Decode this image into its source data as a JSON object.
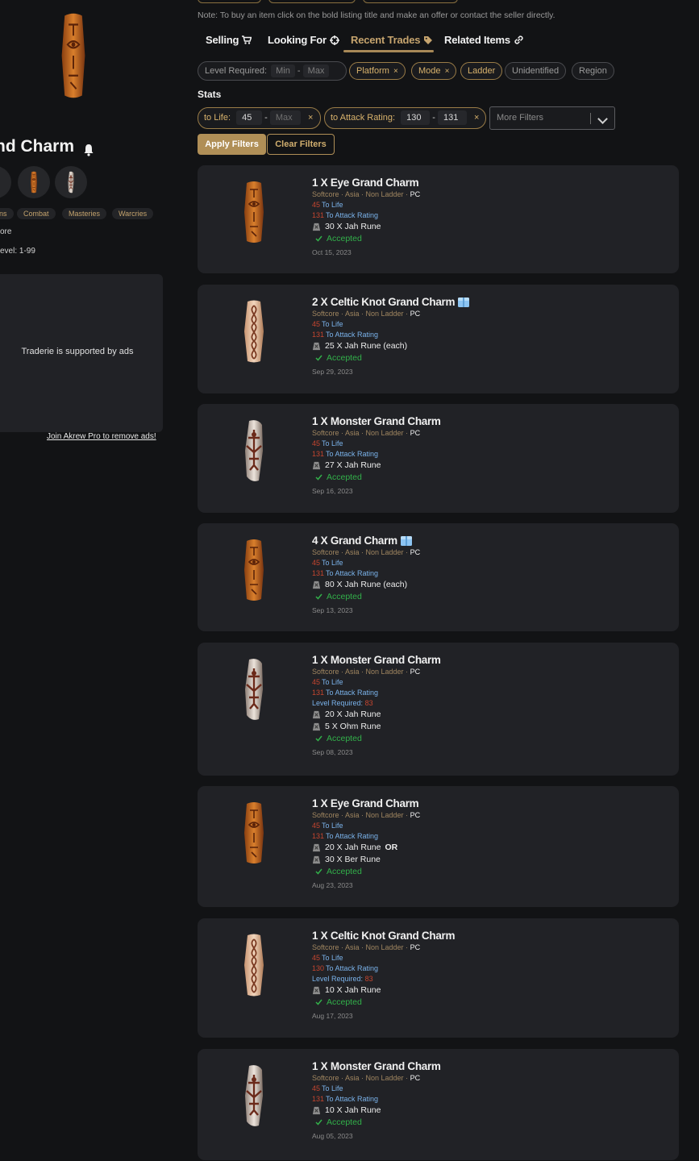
{
  "sidebar": {
    "title": "nd Charm",
    "tags": [
      "ns",
      "Combat",
      "Masteries",
      "Warcries"
    ],
    "info": [
      "ore",
      "evel: 1-99"
    ],
    "ad_text": "Traderie is supported by ads",
    "pro_link": "Join Akrew Pro to remove ads!"
  },
  "note": "Note: To buy an item click on the bold listing title and make an offer or contact the seller directly.",
  "tabs": [
    {
      "label": "Selling",
      "icon": "cart-icon"
    },
    {
      "label": "Looking For",
      "icon": "target-icon"
    },
    {
      "label": "Recent Trades",
      "icon": "tag-icon",
      "active": true
    },
    {
      "label": "Related Items",
      "icon": "link-icon"
    }
  ],
  "filters": {
    "level_label": "Level Required:",
    "min_placeholder": "Min",
    "max_placeholder": "Max",
    "dash": "-",
    "platform": "Platform",
    "mode": "Mode",
    "ladder": "Ladder",
    "unidentified": "Unidentified",
    "region": "Region",
    "remove": "×"
  },
  "stats": {
    "label": "Stats",
    "life": {
      "label": "to Life:",
      "min": "45",
      "max_placeholder": "Max"
    },
    "attack": {
      "label": "to Attack Rating:",
      "min": "130",
      "max": "131"
    },
    "more_filters": "More Filters"
  },
  "buttons": {
    "apply": "Apply Filters",
    "clear": "Clear Filters"
  },
  "trades": [
    {
      "title": "1 X Eye Grand Charm",
      "charm": "eye",
      "box": false,
      "meta": "Softcore · Asia · Non Ladder · ",
      "platform": "PC",
      "life_val": "45",
      "life_label": "To Life",
      "ar_val": "131",
      "ar_label": "To Attack Rating",
      "level_label": "",
      "level_val": "",
      "offer1": "30 X Jah Rune",
      "offer_or": "",
      "offer2": "",
      "status": "Accepted",
      "date": "Oct 15, 2023"
    },
    {
      "title": "2 X Celtic Knot Grand Charm",
      "charm": "celtic",
      "box": true,
      "meta": "Softcore · Asia · Non Ladder · ",
      "platform": "PC",
      "life_val": "45",
      "life_label": "To Life",
      "ar_val": "131",
      "ar_label": "To Attack Rating",
      "level_label": "",
      "level_val": "",
      "offer1": "25 X Jah Rune (each)",
      "offer_or": "",
      "offer2": "",
      "status": "Accepted",
      "date": "Sep 29, 2023"
    },
    {
      "title": "1 X Monster Grand Charm",
      "charm": "monster",
      "box": false,
      "meta": "Softcore · Asia · Non Ladder · ",
      "platform": "PC",
      "life_val": "45",
      "life_label": "To Life",
      "ar_val": "131",
      "ar_label": "To Attack Rating",
      "level_label": "",
      "level_val": "",
      "offer1": "27 X Jah Rune",
      "offer_or": "",
      "offer2": "",
      "status": "Accepted",
      "date": "Sep 16, 2023"
    },
    {
      "title": "4 X Grand Charm",
      "charm": "eye",
      "box": true,
      "meta": "Softcore · Asia · Non Ladder · ",
      "platform": "PC",
      "life_val": "45",
      "life_label": "To Life",
      "ar_val": "131",
      "ar_label": "To Attack Rating",
      "level_label": "",
      "level_val": "",
      "offer1": "80 X Jah Rune (each)",
      "offer_or": "",
      "offer2": "",
      "status": "Accepted",
      "date": "Sep 13, 2023"
    },
    {
      "title": "1 X Monster Grand Charm",
      "charm": "monster",
      "box": false,
      "meta": "Softcore · Asia · Non Ladder · ",
      "platform": "PC",
      "life_val": "45",
      "life_label": "To Life",
      "ar_val": "131",
      "ar_label": "To Attack Rating",
      "level_label": "Level Required:",
      "level_val": "83",
      "offer1": "20 X Jah Rune",
      "offer_or": "",
      "offer2": "5 X Ohm Rune",
      "status": "Accepted",
      "date": "Sep 08, 2023"
    },
    {
      "title": "1 X Eye Grand Charm",
      "charm": "eye",
      "box": false,
      "meta": "Softcore · Asia · Non Ladder · ",
      "platform": "PC",
      "life_val": "45",
      "life_label": "To Life",
      "ar_val": "131",
      "ar_label": "To Attack Rating",
      "level_label": "",
      "level_val": "",
      "offer1": "20 X Jah Rune",
      "offer_or": "OR",
      "offer2": "30 X Ber Rune",
      "status": "Accepted",
      "date": "Aug 23, 2023"
    },
    {
      "title": "1 X Celtic Knot Grand Charm",
      "charm": "celtic",
      "box": false,
      "meta": "Softcore · Asia · Non Ladder · ",
      "platform": "PC",
      "life_val": "45",
      "life_label": "To Life",
      "ar_val": "130",
      "ar_label": "To Attack Rating",
      "level_label": "Level Required:",
      "level_val": "83",
      "offer1": "10 X Jah Rune",
      "offer_or": "",
      "offer2": "",
      "status": "Accepted",
      "date": "Aug 17, 2023"
    },
    {
      "title": "1 X Monster Grand Charm",
      "charm": "monster",
      "box": false,
      "meta": "Softcore · Asia · Non Ladder · ",
      "platform": "PC",
      "life_val": "45",
      "life_label": "To Life",
      "ar_val": "131",
      "ar_label": "To Attack Rating",
      "level_label": "",
      "level_val": "",
      "offer1": "10 X Jah Rune",
      "offer_or": "",
      "offer2": "",
      "status": "Accepted",
      "date": "Aug 05, 2023"
    }
  ]
}
